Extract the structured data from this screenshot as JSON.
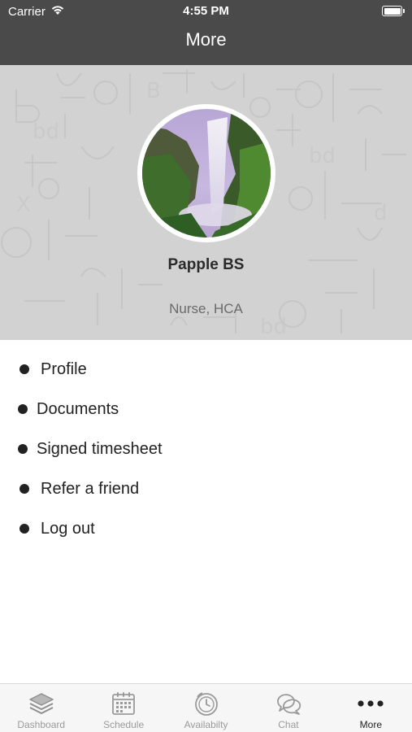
{
  "status_bar": {
    "carrier": "Carrier",
    "time": "4:55 PM",
    "icons": [
      "wifi-icon",
      "battery-icon"
    ]
  },
  "nav": {
    "title": "More"
  },
  "profile": {
    "name": "Papple BS",
    "role": "Nurse, HCA",
    "avatar": "waterfall-photo"
  },
  "menu": {
    "items": [
      {
        "label": "Profile"
      },
      {
        "label": "Documents"
      },
      {
        "label": "Signed timesheet"
      },
      {
        "label": "Refer a friend"
      },
      {
        "label": "Log out"
      }
    ]
  },
  "tab_bar": {
    "tabs": [
      {
        "label": "Dashboard",
        "icon": "layers-icon"
      },
      {
        "label": "Schedule",
        "icon": "calendar-icon"
      },
      {
        "label": "Availabilty",
        "icon": "clock-icon"
      },
      {
        "label": "Chat",
        "icon": "chat-bubbles-icon"
      },
      {
        "label": "More",
        "icon": "more-dots-icon",
        "active": true
      }
    ]
  },
  "colors": {
    "nav_background": "#4a4a4a",
    "header_background": "#d2d2d2",
    "tab_inactive": "#9a9a9a",
    "tab_active": "#222222"
  }
}
